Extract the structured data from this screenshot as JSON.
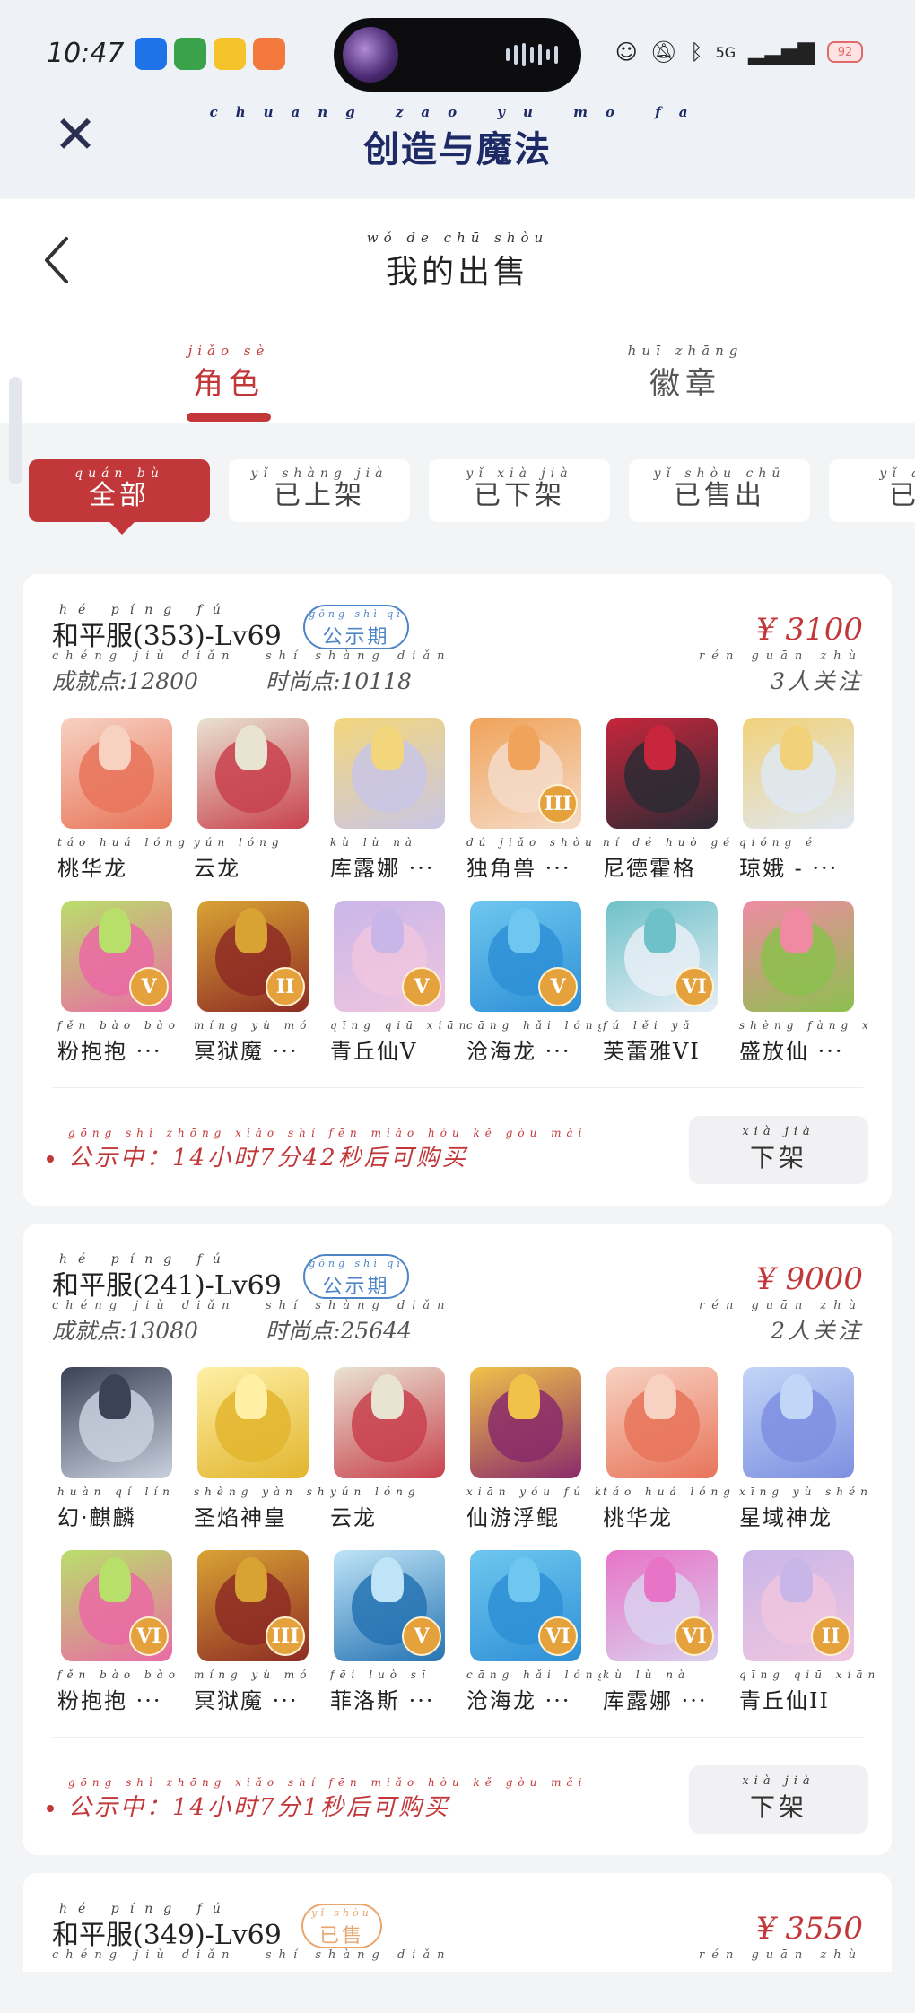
{
  "status": {
    "time": "10:47",
    "network": "5G",
    "battery": "92",
    "app_icons": [
      {
        "name": "ai-app-icon",
        "color": "#1e73e8"
      },
      {
        "name": "house-app-icon",
        "color": "#3aa24a"
      },
      {
        "name": "rabbit-app-icon",
        "color": "#f5c42a"
      },
      {
        "name": "orange-app-icon",
        "color": "#f2793b"
      }
    ]
  },
  "app": {
    "title_pinyin": "chuang zao yu mo fa",
    "title": "创造与魔法"
  },
  "page": {
    "title_pinyin": "wǒ de chū shòu",
    "title": "我的出售",
    "tabs": [
      {
        "pinyin": "jiǎo sè",
        "label": "角色",
        "active": true
      },
      {
        "pinyin": "huī zhāng",
        "label": "徽章",
        "active": false
      }
    ],
    "filters": [
      {
        "pinyin": "quán bù",
        "label": "全部",
        "active": true
      },
      {
        "pinyin": "yǐ shàng jià",
        "label": "已上架",
        "active": false
      },
      {
        "pinyin": "yǐ xià jià",
        "label": "已下架",
        "active": false
      },
      {
        "pinyin": "yǐ shòu chū",
        "label": "已售出",
        "active": false
      },
      {
        "pinyin": "yǐ qǔ x",
        "label": "已取",
        "active": false
      }
    ]
  },
  "listings": [
    {
      "title_pinyin": "hé píng fú",
      "title": "和平服(353)-Lv69",
      "status_pinyin": "gōng shì qī",
      "status": "公示期",
      "price": "¥ 3100",
      "achievement_pinyin": "chéng jiù diǎn",
      "achievement": "成就点:12800",
      "fashion_pinyin": "shí shàng diǎn",
      "fashion": "时尚点:10118",
      "followers_pinyin": "rén guān zhù",
      "followers": "3人关注",
      "pets": [
        {
          "pinyin": "táo huá lóng",
          "name": "桃华龙",
          "tier": "",
          "color": "#e8745a",
          "accent": "#f7d2c2"
        },
        {
          "pinyin": "yún lóng",
          "name": "云龙",
          "tier": "",
          "color": "#c8414d",
          "accent": "#e9e3d2"
        },
        {
          "pinyin": "kù lù nà",
          "name": "库露娜 ···",
          "tier": "",
          "color": "#c9c6e6",
          "accent": "#f3d67c"
        },
        {
          "pinyin": "dú jiǎo shòu",
          "name": "独角兽 ···",
          "tier": "III",
          "color": "#f5dbc8",
          "accent": "#f0a35a"
        },
        {
          "pinyin": "ní dé huò gé",
          "name": "尼德霍格",
          "tier": "",
          "color": "#2c2a34",
          "accent": "#c7263c"
        },
        {
          "pinyin": "qióng é",
          "name": "琼娥 - ···",
          "tier": "",
          "color": "#dfe7f2",
          "accent": "#f1d27a"
        },
        {
          "pinyin": "fěn bào bào",
          "name": "粉抱抱 ···",
          "tier": "V",
          "color": "#ea6aa5",
          "accent": "#b9df6b"
        },
        {
          "pinyin": "míng yù mó",
          "name": "冥狱魔 ···",
          "tier": "II",
          "color": "#8d2b24",
          "accent": "#d9a334"
        },
        {
          "pinyin": "qīng qiū xiān",
          "name": "青丘仙V",
          "tier": "V",
          "color": "#f0c5df",
          "accent": "#c9b6e9"
        },
        {
          "pinyin": "cāng hǎi lóng",
          "name": "沧海龙 ···",
          "tier": "V",
          "color": "#2e8fd6",
          "accent": "#6fc7ef"
        },
        {
          "pinyin": "fú lěi yǎ",
          "name": "芙蕾雅VI",
          "tier": "VI",
          "color": "#e8eef6",
          "accent": "#6ec1c9"
        },
        {
          "pinyin": "shèng fàng xiān",
          "name": "盛放仙 ···",
          "tier": "",
          "color": "#8cc04e",
          "accent": "#f08aa3"
        }
      ],
      "notice_pinyin": "gōng shì zhōng    xiǎo shí  fēn  miǎo hòu kě gòu mǎi",
      "notice": "公示中：14小时7分42秒后可购买",
      "unlist_pinyin": "xià jià",
      "unlist": "下架"
    },
    {
      "title_pinyin": "hé píng fú",
      "title": "和平服(241)-Lv69",
      "status_pinyin": "gōng shì qī",
      "status": "公示期",
      "price": "¥ 9000",
      "achievement_pinyin": "chéng jiù diǎn",
      "achievement": "成就点:13080",
      "fashion_pinyin": "shí shàng diǎn",
      "fashion": "时尚点:25644",
      "followers_pinyin": "rén guān zhù",
      "followers": "2人关注",
      "pets": [
        {
          "pinyin": "huàn qí lín",
          "name": "幻·麒麟",
          "tier": "",
          "color": "#c9d0de",
          "accent": "#3b4256"
        },
        {
          "pinyin": "shèng yàn shén huáng",
          "name": "圣焰神皇",
          "tier": "",
          "color": "#e2b52e",
          "accent": "#fff0a6"
        },
        {
          "pinyin": "yún lóng",
          "name": "云龙",
          "tier": "",
          "color": "#c8414d",
          "accent": "#e9e3d2"
        },
        {
          "pinyin": "xiān yóu fú kūn",
          "name": "仙游浮鲲",
          "tier": "",
          "color": "#8a2a6a",
          "accent": "#f0c24a"
        },
        {
          "pinyin": "táo huá lóng",
          "name": "桃华龙",
          "tier": "",
          "color": "#e8745a",
          "accent": "#f7d2c2"
        },
        {
          "pinyin": "xīng yù shén lóng",
          "name": "星域神龙",
          "tier": "",
          "color": "#7e8fe0",
          "accent": "#c2d6f7"
        },
        {
          "pinyin": "fěn bào bào",
          "name": "粉抱抱 ···",
          "tier": "VI",
          "color": "#ea6aa5",
          "accent": "#b9df6b"
        },
        {
          "pinyin": "míng yù mó",
          "name": "冥狱魔 ···",
          "tier": "III",
          "color": "#8d2b24",
          "accent": "#d9a334"
        },
        {
          "pinyin": "fēi luò sī",
          "name": "菲洛斯 ···",
          "tier": "V",
          "color": "#2673b3",
          "accent": "#bfe4f7"
        },
        {
          "pinyin": "cāng hǎi lóng",
          "name": "沧海龙 ···",
          "tier": "VI",
          "color": "#2e8fd6",
          "accent": "#6fc7ef"
        },
        {
          "pinyin": "kù lù nà",
          "name": "库露娜 ···",
          "tier": "VI",
          "color": "#d9d0ee",
          "accent": "#e874c7"
        },
        {
          "pinyin": "qīng qiū xiān",
          "name": "青丘仙II",
          "tier": "II",
          "color": "#f0c5df",
          "accent": "#c9b6e9"
        }
      ],
      "notice_pinyin": "gōng shì zhōng    xiǎo shí  fēn  miǎo hòu kě gòu mǎi",
      "notice": "公示中：14小时7分1秒后可购买",
      "unlist_pinyin": "xià jià",
      "unlist": "下架"
    },
    {
      "title_pinyin": "hé píng fú",
      "title": "和平服(349)-Lv69",
      "status_pinyin": "yǐ shòu",
      "status": "已售",
      "price": "¥ 3550",
      "achievement_pinyin": "chéng jiù diǎn",
      "achievement": "",
      "fashion_pinyin": "shí shàng diǎn",
      "fashion": "",
      "followers_pinyin": "rén guān zhù",
      "followers": ""
    }
  ],
  "colors": {
    "accent": "#c2383a",
    "badge_blue": "#4d84c6",
    "badge_sold": "#e8a56e",
    "tier_gold": "#e4a13c"
  }
}
